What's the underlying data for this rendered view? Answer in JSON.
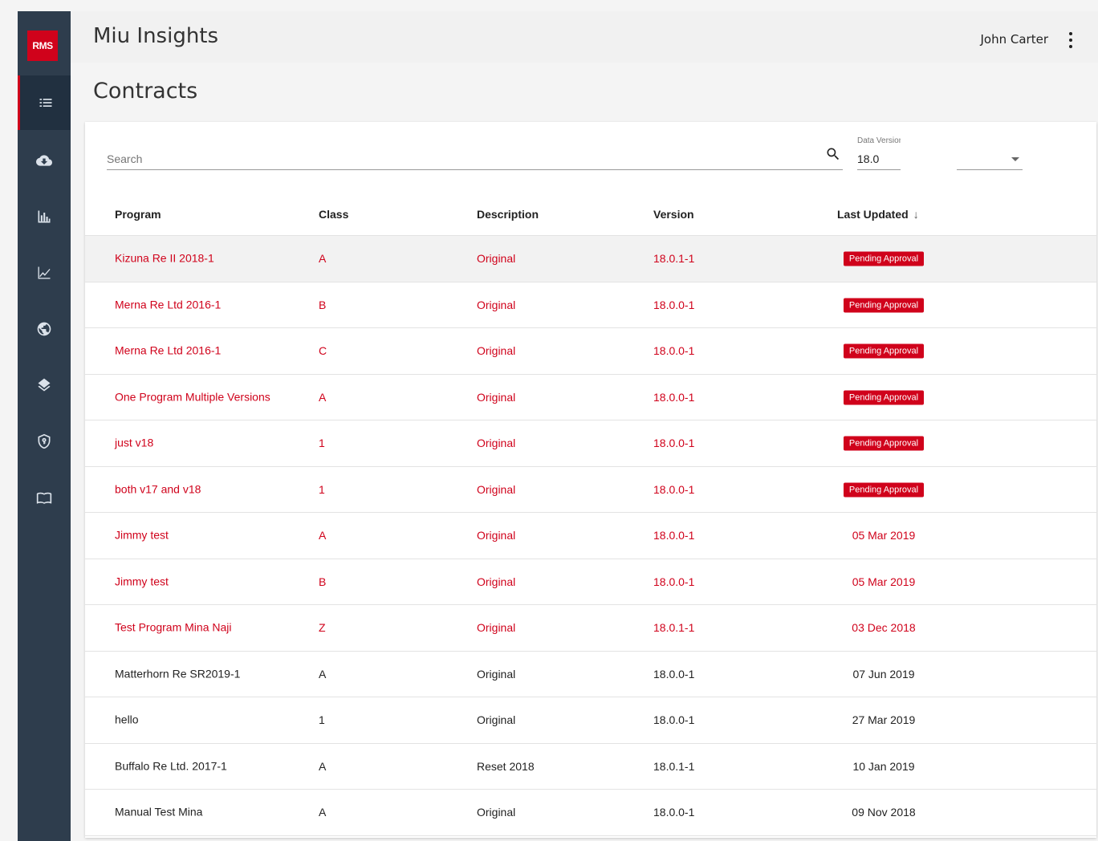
{
  "app": {
    "logo_text": "RMS",
    "title": "Miu Insights",
    "user_name": "John Carter"
  },
  "sidebar": {
    "items": [
      {
        "icon": "list-icon",
        "active": true
      },
      {
        "icon": "cloud-download-icon",
        "active": false
      },
      {
        "icon": "bar-chart-icon",
        "active": false
      },
      {
        "icon": "line-chart-icon",
        "active": false
      },
      {
        "icon": "globe-icon",
        "active": false
      },
      {
        "icon": "layers-icon",
        "active": false
      },
      {
        "icon": "shield-icon",
        "active": false
      },
      {
        "icon": "book-icon",
        "active": false
      }
    ]
  },
  "page": {
    "title": "Contracts"
  },
  "search": {
    "placeholder": "Search"
  },
  "data_version": {
    "label": "Data Version",
    "value": "18.0"
  },
  "table": {
    "headers": {
      "program": "Program",
      "class": "Class",
      "description": "Description",
      "version": "Version",
      "last_updated": "Last Updated",
      "sort_arrow": "↓"
    },
    "rows": [
      {
        "program": "Kizuna Re II 2018-1",
        "class": "A",
        "description": "Original",
        "version": "18.0.1-1",
        "last_updated": "Pending Approval",
        "pending": true,
        "red": true
      },
      {
        "program": "Merna Re Ltd 2016-1",
        "class": "B",
        "description": "Original",
        "version": "18.0.0-1",
        "last_updated": "Pending Approval",
        "pending": true,
        "red": true
      },
      {
        "program": "Merna Re Ltd 2016-1",
        "class": "C",
        "description": "Original",
        "version": "18.0.0-1",
        "last_updated": "Pending Approval",
        "pending": true,
        "red": true
      },
      {
        "program": "One Program Multiple Versions",
        "class": "A",
        "description": "Original",
        "version": "18.0.0-1",
        "last_updated": "Pending Approval",
        "pending": true,
        "red": true
      },
      {
        "program": "just v18",
        "class": "1",
        "description": "Original",
        "version": "18.0.0-1",
        "last_updated": "Pending Approval",
        "pending": true,
        "red": true
      },
      {
        "program": "both v17 and v18",
        "class": "1",
        "description": "Original",
        "version": "18.0.0-1",
        "last_updated": "Pending Approval",
        "pending": true,
        "red": true
      },
      {
        "program": "Jimmy test",
        "class": "A",
        "description": "Original",
        "version": "18.0.0-1",
        "last_updated": "05 Mar 2019",
        "pending": false,
        "red": true
      },
      {
        "program": "Jimmy test",
        "class": "B",
        "description": "Original",
        "version": "18.0.0-1",
        "last_updated": "05 Mar 2019",
        "pending": false,
        "red": true
      },
      {
        "program": "Test Program Mina Naji",
        "class": "Z",
        "description": "Original",
        "version": "18.0.1-1",
        "last_updated": "03 Dec 2018",
        "pending": false,
        "red": true
      },
      {
        "program": "Matterhorn Re SR2019-1",
        "class": "A",
        "description": "Original",
        "version": "18.0.0-1",
        "last_updated": "07 Jun 2019",
        "pending": false,
        "red": false
      },
      {
        "program": "hello",
        "class": "1",
        "description": "Original",
        "version": "18.0.0-1",
        "last_updated": "27 Mar 2019",
        "pending": false,
        "red": false
      },
      {
        "program": "Buffalo Re Ltd. 2017-1",
        "class": "A",
        "description": "Reset 2018",
        "version": "18.0.1-1",
        "last_updated": "10 Jan 2019",
        "pending": false,
        "red": false
      },
      {
        "program": "Manual Test Mina",
        "class": "A",
        "description": "Original",
        "version": "18.0.0-1",
        "last_updated": "09 Nov 2018",
        "pending": false,
        "red": false
      }
    ]
  },
  "colors": {
    "accent": "#d0021b",
    "sidebar": "#2e3d4d"
  }
}
